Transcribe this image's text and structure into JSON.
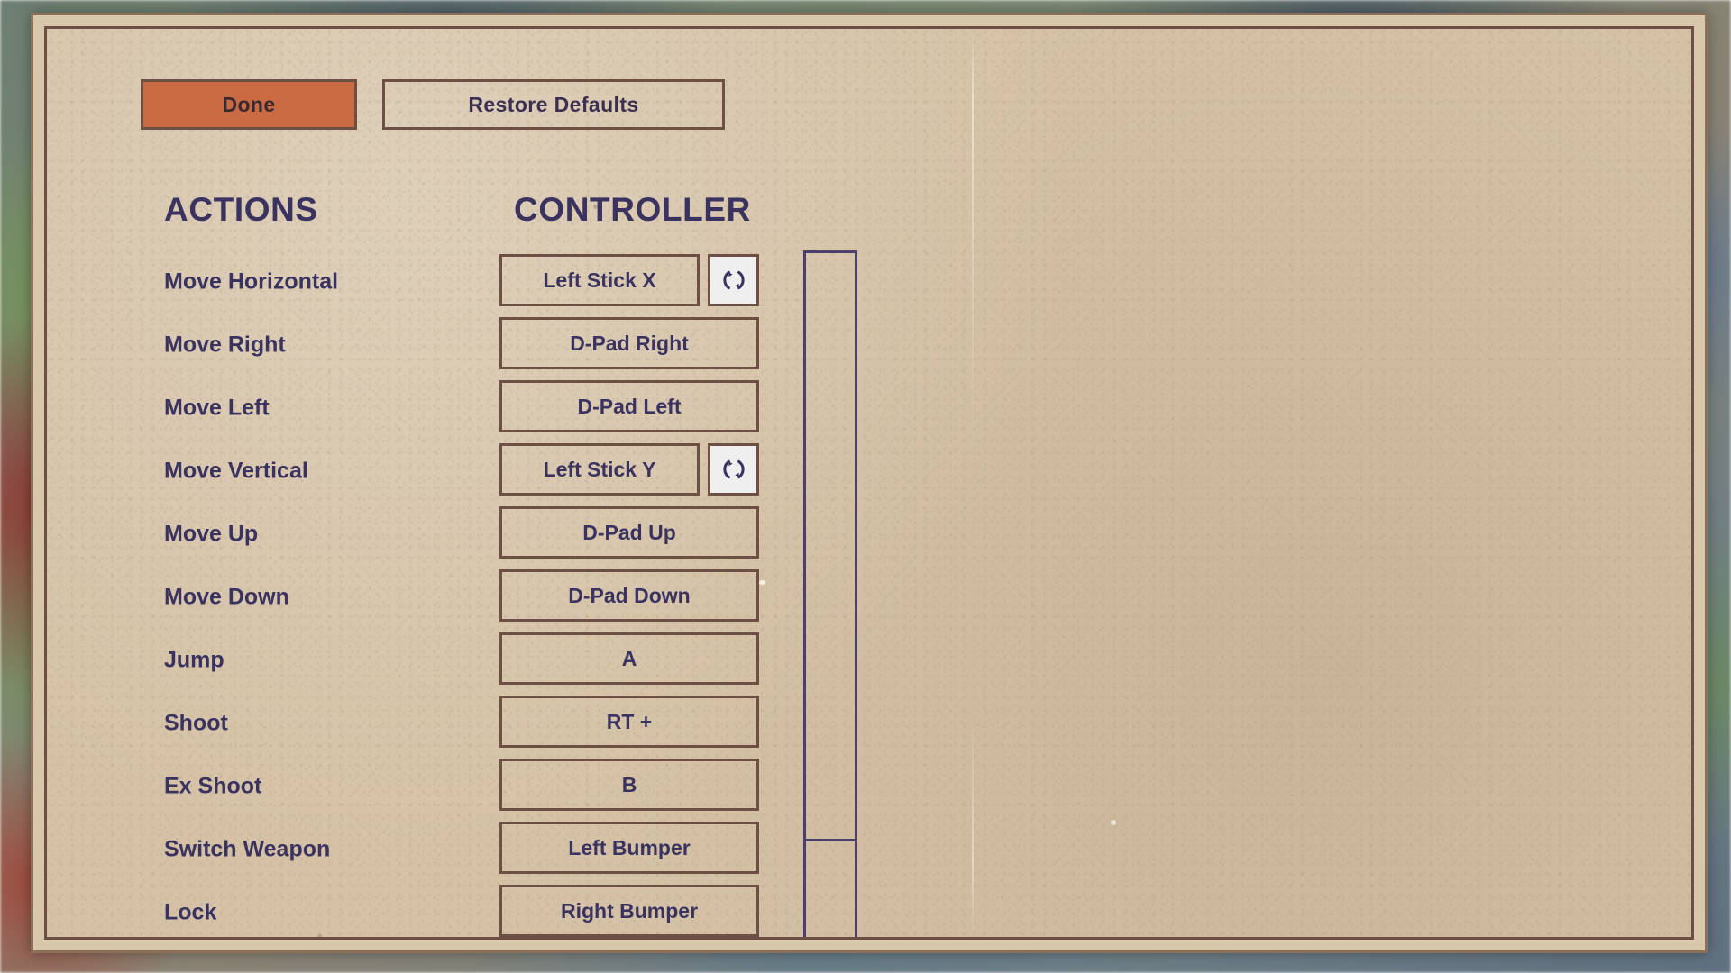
{
  "toolbar": {
    "done_label": "Done",
    "restore_label": "Restore Defaults"
  },
  "headers": {
    "actions": "ACTIONS",
    "controller": "CONTROLLER"
  },
  "colors": {
    "accent_orange": "#c96a42",
    "panel_background": "#d5c2a6",
    "panel_border": "#6d4f43",
    "text": "#3a3360",
    "scrollbar": "#4c3f6e"
  },
  "bindings": [
    {
      "action": "Move Horizontal",
      "binding": "Left Stick X",
      "has_invert": true,
      "invert_icon": "rotate-icon"
    },
    {
      "action": "Move Right",
      "binding": "D-Pad Right",
      "has_invert": false
    },
    {
      "action": "Move Left",
      "binding": "D-Pad Left",
      "has_invert": false
    },
    {
      "action": "Move Vertical",
      "binding": "Left Stick Y",
      "has_invert": true,
      "invert_icon": "rotate-icon"
    },
    {
      "action": "Move Up",
      "binding": "D-Pad Up",
      "has_invert": false
    },
    {
      "action": "Move Down",
      "binding": "D-Pad Down",
      "has_invert": false
    },
    {
      "action": "Jump",
      "binding": "A",
      "has_invert": false
    },
    {
      "action": "Shoot",
      "binding": "RT +",
      "has_invert": false
    },
    {
      "action": "Ex Shoot",
      "binding": "B",
      "has_invert": false
    },
    {
      "action": "Switch Weapon",
      "binding": "Left Bumper",
      "has_invert": false
    },
    {
      "action": "Lock",
      "binding": "Right Bumper",
      "has_invert": false
    }
  ],
  "scrollbar": {
    "thumb_position_percent": 0,
    "thumb_size_percent": 86
  }
}
